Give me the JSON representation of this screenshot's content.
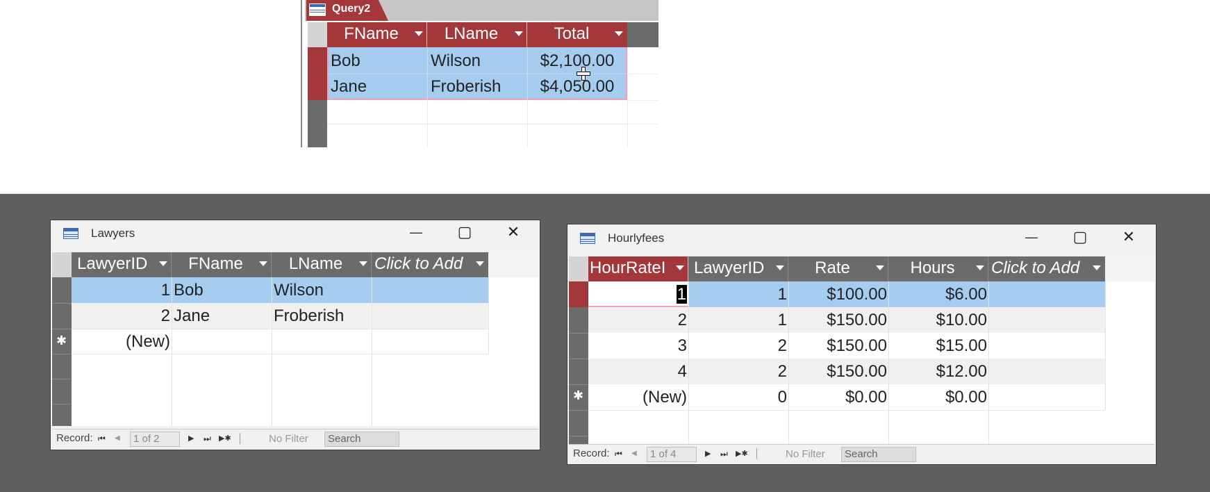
{
  "query": {
    "tab_label": "Query2",
    "columns": [
      "FName",
      "LName",
      "Total"
    ],
    "rows": [
      [
        "Bob",
        "Wilson",
        "$2,100.00"
      ],
      [
        "Jane",
        "Froberish",
        "$4,050.00"
      ]
    ]
  },
  "lawyers": {
    "title": "Lawyers",
    "columns": [
      "LawyerID",
      "FName",
      "LName",
      "Click to Add"
    ],
    "rows": [
      [
        "1",
        "Bob",
        "Wilson",
        ""
      ],
      [
        "2",
        "Jane",
        "Froberish",
        ""
      ]
    ],
    "new_row": "(New)",
    "new_marker": "✱",
    "nav": {
      "record_label": "Record:",
      "position": "1 of 2",
      "filter": "No Filter",
      "search": "Search"
    }
  },
  "hourlyfees": {
    "title": "Hourlyfees",
    "columns": [
      "HourRateI",
      "LawyerID",
      "Rate",
      "Hours",
      "Click to Add"
    ],
    "rows": [
      [
        "1",
        "1",
        "$100.00",
        "$6.00",
        ""
      ],
      [
        "2",
        "1",
        "$150.00",
        "$10.00",
        ""
      ],
      [
        "3",
        "2",
        "$150.00",
        "$15.00",
        ""
      ],
      [
        "4",
        "2",
        "$150.00",
        "$12.00",
        ""
      ]
    ],
    "new_row": [
      "(New)",
      "0",
      "$0.00",
      "$0.00"
    ],
    "new_marker": "✱",
    "nav": {
      "record_label": "Record:",
      "position": "1 of 4",
      "filter": "No Filter",
      "search": "Search"
    }
  },
  "colors": {
    "accent_red": "#a4373a",
    "selection_blue": "#a6cdf0",
    "workspace_gray": "#5f5f5f"
  },
  "window_controls": {
    "minimize": "—",
    "maximize": "▢",
    "close": "✕"
  },
  "nav_glyphs": {
    "first": "⏮",
    "prev": "◀",
    "next": "▶",
    "last": "⏭",
    "new": "▶✱"
  }
}
